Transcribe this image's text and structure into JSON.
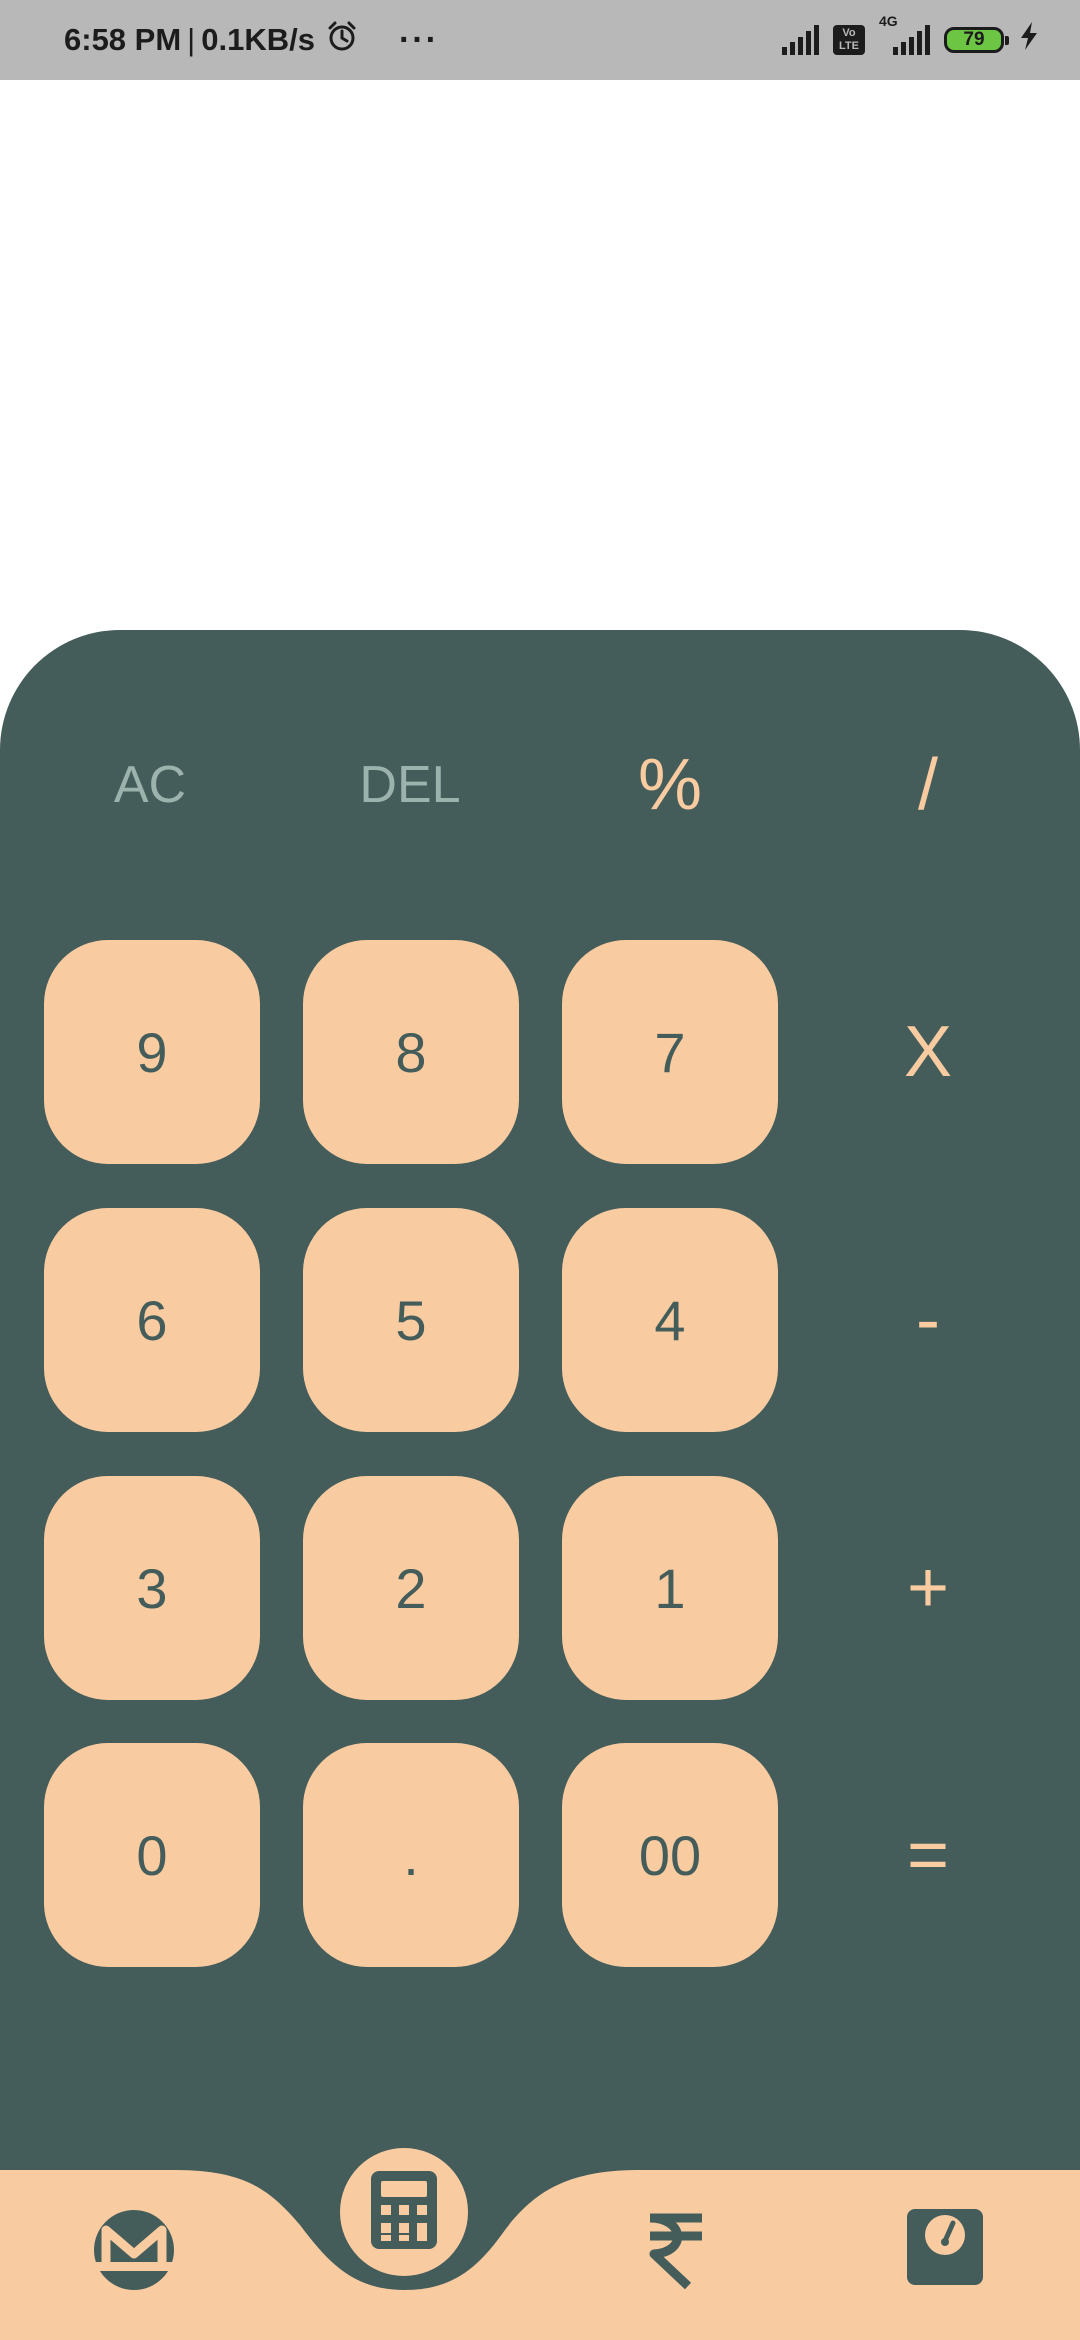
{
  "status_bar": {
    "time": "6:58 PM",
    "separator": "|",
    "speed": "0.1KB/s",
    "alarm_icon": "alarm-clock-icon",
    "more": "···",
    "volte_line1": "Vo",
    "volte_line2": "LTE",
    "network": "4G",
    "battery": "79"
  },
  "keypad": {
    "top_row": [
      "AC",
      "DEL",
      "%",
      "/"
    ],
    "rows": [
      {
        "keys": [
          "9",
          "8",
          "7"
        ],
        "op": "X"
      },
      {
        "keys": [
          "6",
          "5",
          "4"
        ],
        "op": "-"
      },
      {
        "keys": [
          "3",
          "2",
          "1"
        ],
        "op": "+"
      },
      {
        "keys": [
          "0",
          ".",
          "00"
        ],
        "op": "="
      }
    ]
  },
  "bottom_nav": {
    "items": [
      "monero-icon",
      "calculator-icon",
      "rupee-icon",
      "scale-icon"
    ],
    "active": "calculator-icon"
  },
  "colors": {
    "panel": "#445d5a",
    "accent": "#f9cba1",
    "muted": "#9cb2ad",
    "status_bar": "#b8b8b8"
  }
}
